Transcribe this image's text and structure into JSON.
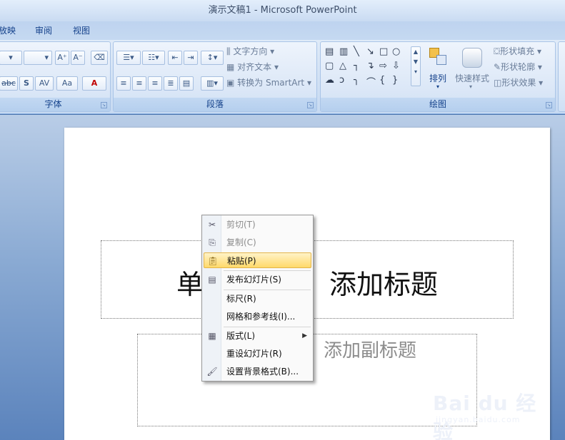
{
  "window": {
    "title": "演示文稿1 - Microsoft PowerPoint"
  },
  "tabs": [
    {
      "label": "放映"
    },
    {
      "label": "审阅"
    },
    {
      "label": "视图"
    }
  ],
  "ribbon": {
    "font_group": {
      "label": "字体",
      "grow_label": "A⁺",
      "shrink_label": "A⁻",
      "strike_label": "abc",
      "shadow_label": "S",
      "spacing_label": "AV",
      "case_label": "Aa",
      "color_label": "A"
    },
    "paragraph_group": {
      "label": "段落",
      "text_direction": "文字方向",
      "align_text": "对齐文本",
      "convert_smartart": "转换为 SmartArt"
    },
    "drawing_group": {
      "label": "绘图",
      "arrange": "排列",
      "quick_styles": "快速样式",
      "shape_fill": "形状填充",
      "shape_outline": "形状轮廓",
      "shape_effects": "形状效果"
    }
  },
  "slide": {
    "title_visible_left": "单",
    "title_visible_right": "添加标题",
    "subtitle_visible": "添加副标题"
  },
  "context_menu": {
    "items": [
      {
        "label": "剪切(T)",
        "icon": "scissors-icon",
        "enabled": false
      },
      {
        "label": "复制(C)",
        "icon": "copy-icon",
        "enabled": false
      },
      {
        "label": "粘贴(P)",
        "icon": "paste-icon",
        "enabled": true,
        "highlighted": true
      },
      {
        "label": "发布幻灯片(S)",
        "icon": "publish-slides-icon",
        "enabled": true
      },
      {
        "label": "标尺(R)",
        "icon": "",
        "enabled": true
      },
      {
        "label": "网格和参考线(I)...",
        "icon": "",
        "enabled": true
      },
      {
        "label": "版式(L)",
        "icon": "layout-icon",
        "enabled": true,
        "submenu": true
      },
      {
        "label": "重设幻灯片(R)",
        "icon": "",
        "enabled": true
      },
      {
        "label": "设置背景格式(B)...",
        "icon": "background-format-icon",
        "enabled": true
      }
    ]
  },
  "watermark": {
    "main": "Bai du 经验",
    "sub": "jingyan.baidu.com"
  }
}
